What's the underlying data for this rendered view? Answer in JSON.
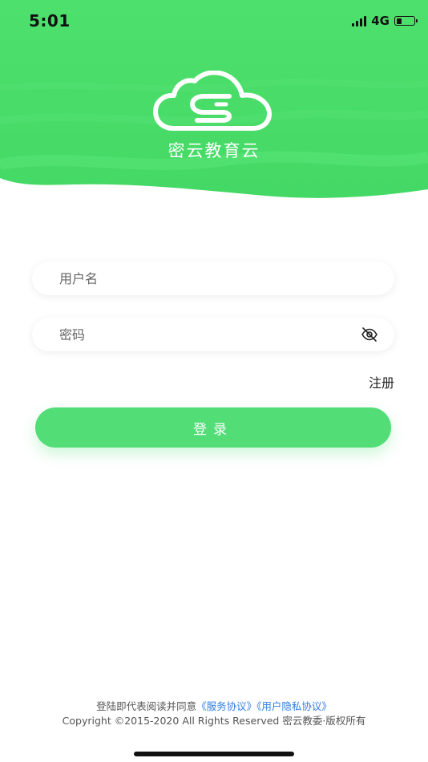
{
  "status_bar": {
    "time": "5:01",
    "network": "4G",
    "battery_level": 0.3
  },
  "header": {
    "app_name": "密云教育云",
    "logo_icon": "cloud-logo-icon",
    "color": "#4fdc6f"
  },
  "login_form": {
    "username_placeholder": "用户名",
    "password_placeholder": "密码",
    "password_toggle_icon": "eye-slash-icon",
    "register_label": "注册",
    "login_label": "登录",
    "button_color": "#52dd77"
  },
  "footer": {
    "agreement_prefix": "登陆即代表阅读并同意",
    "service_agreement": "《服务协议》",
    "privacy_agreement": "《用户隐私协议》",
    "copyright": "Copyright ©2015-2020 All Rights Reserved 密云教委·版权所有",
    "link_color": "#2f7de1"
  }
}
